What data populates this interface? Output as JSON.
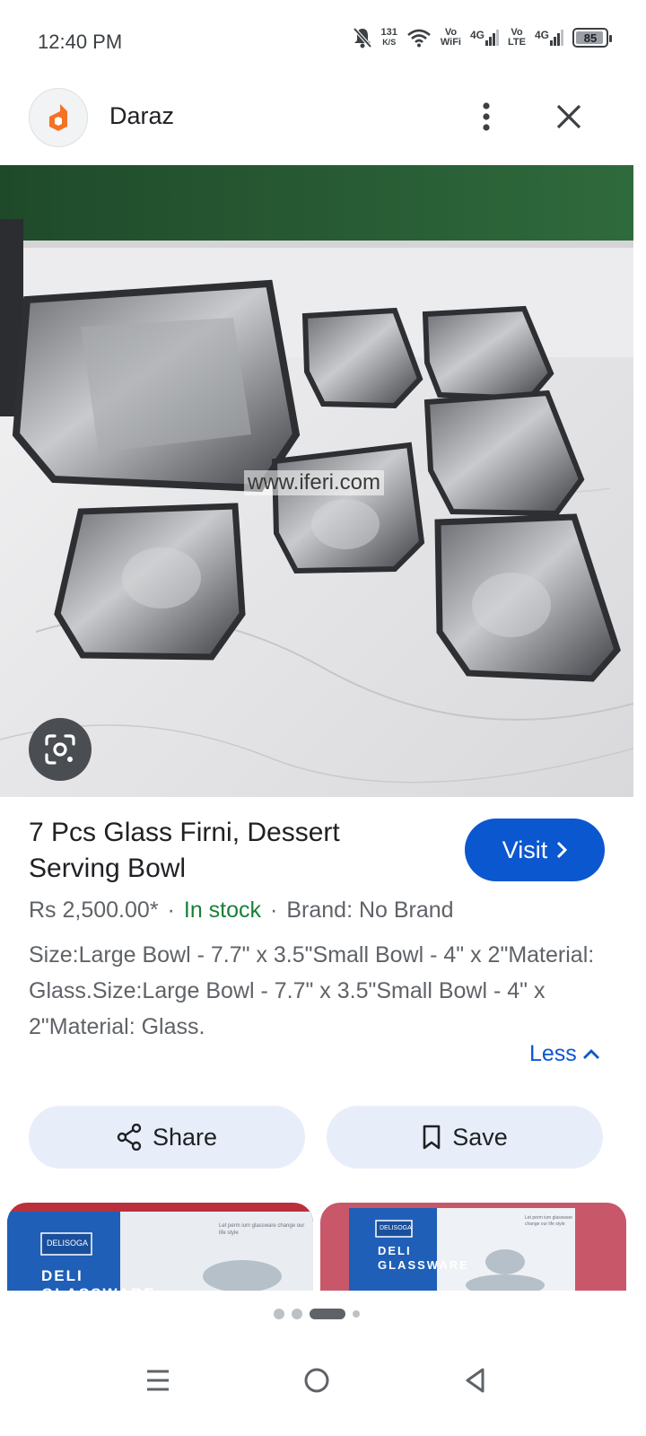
{
  "status_bar": {
    "time": "12:40 PM",
    "net_speed_value": "131",
    "net_speed_unit": "K/S",
    "sim1_top": "Vo",
    "sim1_bottom": "WiFi",
    "sim1_net": "4G",
    "sim2_top": "Vo",
    "sim2_bottom": "LTE",
    "sim2_net": "4G",
    "battery_level": "85"
  },
  "app_bar": {
    "site_name": "Daraz",
    "brand_color": "#f57224"
  },
  "hero": {
    "watermark": "www.iferi.com"
  },
  "product": {
    "title": "7 Pcs Glass Firni, Dessert Serving Bowl",
    "visit_label": "Visit",
    "price": "Rs 2,500.00*",
    "separator": "·",
    "stock": "In stock",
    "brand": "Brand: No Brand",
    "description": "Size:Large Bowl - 7.7\" x 3.5\"Small Bowl - 4\" x 2\"Material: Glass.Size:Large Bowl - 7.7\" x 3.5\"Small Bowl - 4\" x 2\"Material: Glass.",
    "less_label": "Less"
  },
  "actions": {
    "share_label": "Share",
    "save_label": "Save"
  },
  "related": {
    "items": [
      {
        "brand": "DELISOGA",
        "text": "DELI GLASSWARE",
        "tagline": "Let perm ium glassware change our life style"
      },
      {
        "brand": "DELISOGA",
        "text": "DELI GLASSWARE",
        "tagline": "Let perm ium glassware change our life style"
      }
    ]
  },
  "colors": {
    "accent": "#0b57d0",
    "in_stock": "#188038",
    "button_bg": "#e8eef9"
  }
}
